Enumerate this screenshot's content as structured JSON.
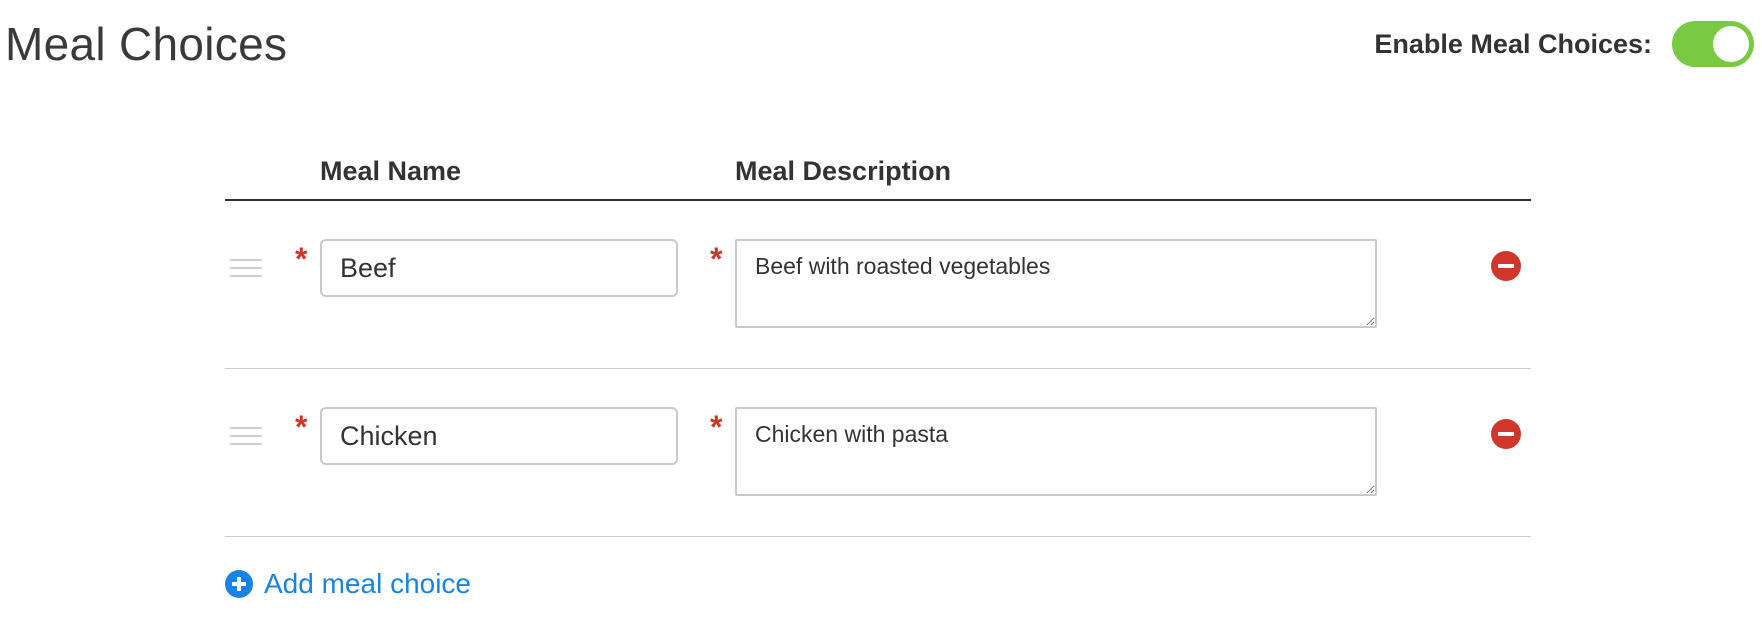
{
  "page": {
    "title": "Meal Choices"
  },
  "enable": {
    "label": "Enable Meal Choices:",
    "enabled": true,
    "on_color": "#7ac943"
  },
  "table": {
    "headers": {
      "name": "Meal Name",
      "description": "Meal Description"
    },
    "required_marker": "*",
    "rows": [
      {
        "name": "Beef",
        "description": "Beef with roasted vegetables"
      },
      {
        "name": "Chicken",
        "description": "Chicken with pasta"
      }
    ]
  },
  "add": {
    "label": "Add meal choice",
    "icon": "plus-circle-icon"
  },
  "icons": {
    "drag": "drag-handle-icon",
    "remove": "minus-circle-icon"
  },
  "colors": {
    "required": "#d0372a",
    "remove": "#d0372a",
    "link": "#1883e3"
  }
}
